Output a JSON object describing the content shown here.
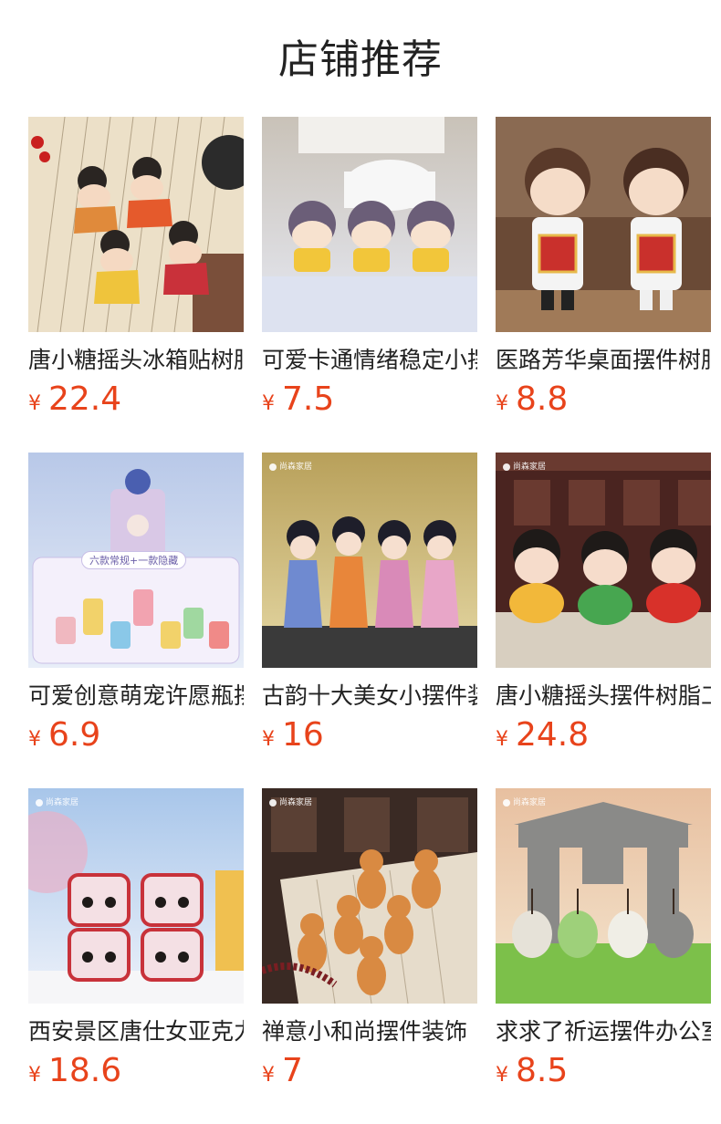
{
  "header": {
    "title": "店铺推荐"
  },
  "currency_symbol": "¥",
  "brand_watermark": "尚森家居",
  "colors": {
    "price": "#e8431b",
    "title": "#222222",
    "background": "#ffffff"
  },
  "products": [
    {
      "name": "唐小糖摇头冰箱贴树脂",
      "price": "22.4",
      "image": "tang-dynasty-fridge-magnets",
      "watermark": ""
    },
    {
      "name": "可爱卡通情绪稳定小摆件",
      "price": "7.5",
      "image": "cartoon-monk-figurines",
      "watermark": ""
    },
    {
      "name": "医路芳华桌面摆件树脂",
      "price": "8.8",
      "image": "doctor-nurse-figurines",
      "watermark": ""
    },
    {
      "name": "可爱创意萌宠许愿瓶摆件",
      "price": "6.9",
      "image": "wishing-bottle-pets",
      "watermark": "",
      "inset_label": "六款常规+一款隐藏"
    },
    {
      "name": "古韵十大美女小摆件装饰",
      "price": "16",
      "image": "ancient-beauties-figurines",
      "watermark": "尚森家居"
    },
    {
      "name": "唐小糖摇头摆件树脂工艺",
      "price": "24.8",
      "image": "tang-bobblehead-figurines",
      "watermark": "尚森家居"
    },
    {
      "name": "西安景区唐仕女亚克力摆件",
      "price": "18.6",
      "image": "xian-tang-lady-acrylic",
      "watermark": "尚森家居"
    },
    {
      "name": "禅意小和尚摆件装饰",
      "price": "7",
      "image": "zen-little-monks",
      "watermark": "尚森家居"
    },
    {
      "name": "求求了祈运摆件办公室",
      "price": "8.5",
      "image": "praying-frogs-figurines",
      "watermark": "尚森家居"
    }
  ]
}
